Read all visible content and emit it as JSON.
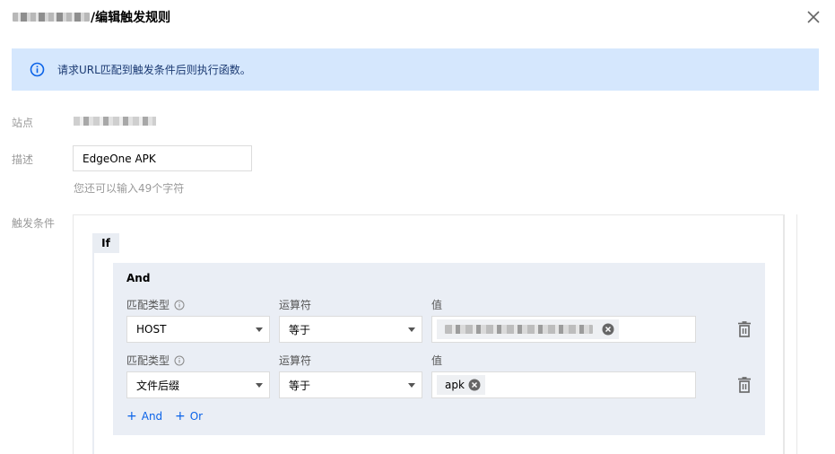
{
  "dialog": {
    "title_suffix": "/编辑触发规则",
    "close_icon": "close-icon"
  },
  "alert": {
    "icon": "info-icon",
    "message": "请求URL匹配到触发条件后则执行函数。",
    "background": "#d5e7fd"
  },
  "form": {
    "site_label": "站点",
    "desc_label": "描述",
    "desc_value": "EdgeOne APK",
    "desc_hint": "您还可以输入49个字符",
    "trigger_label": "触发条件"
  },
  "condition": {
    "if_label": "If",
    "and_label": "And",
    "rows": [
      {
        "match_type_label": "匹配类型",
        "operator_label": "运算符",
        "value_label": "值",
        "match_type": "HOST",
        "operator": "等于",
        "value_chip": ""
      },
      {
        "match_type_label": "匹配类型",
        "operator_label": "运算符",
        "value_label": "值",
        "match_type": "文件后缀",
        "operator": "等于",
        "value_chip": "apk"
      }
    ],
    "add_and": "And",
    "add_or": "Or"
  },
  "colors": {
    "accent": "#0b63e8",
    "panel": "#eaeef5"
  }
}
